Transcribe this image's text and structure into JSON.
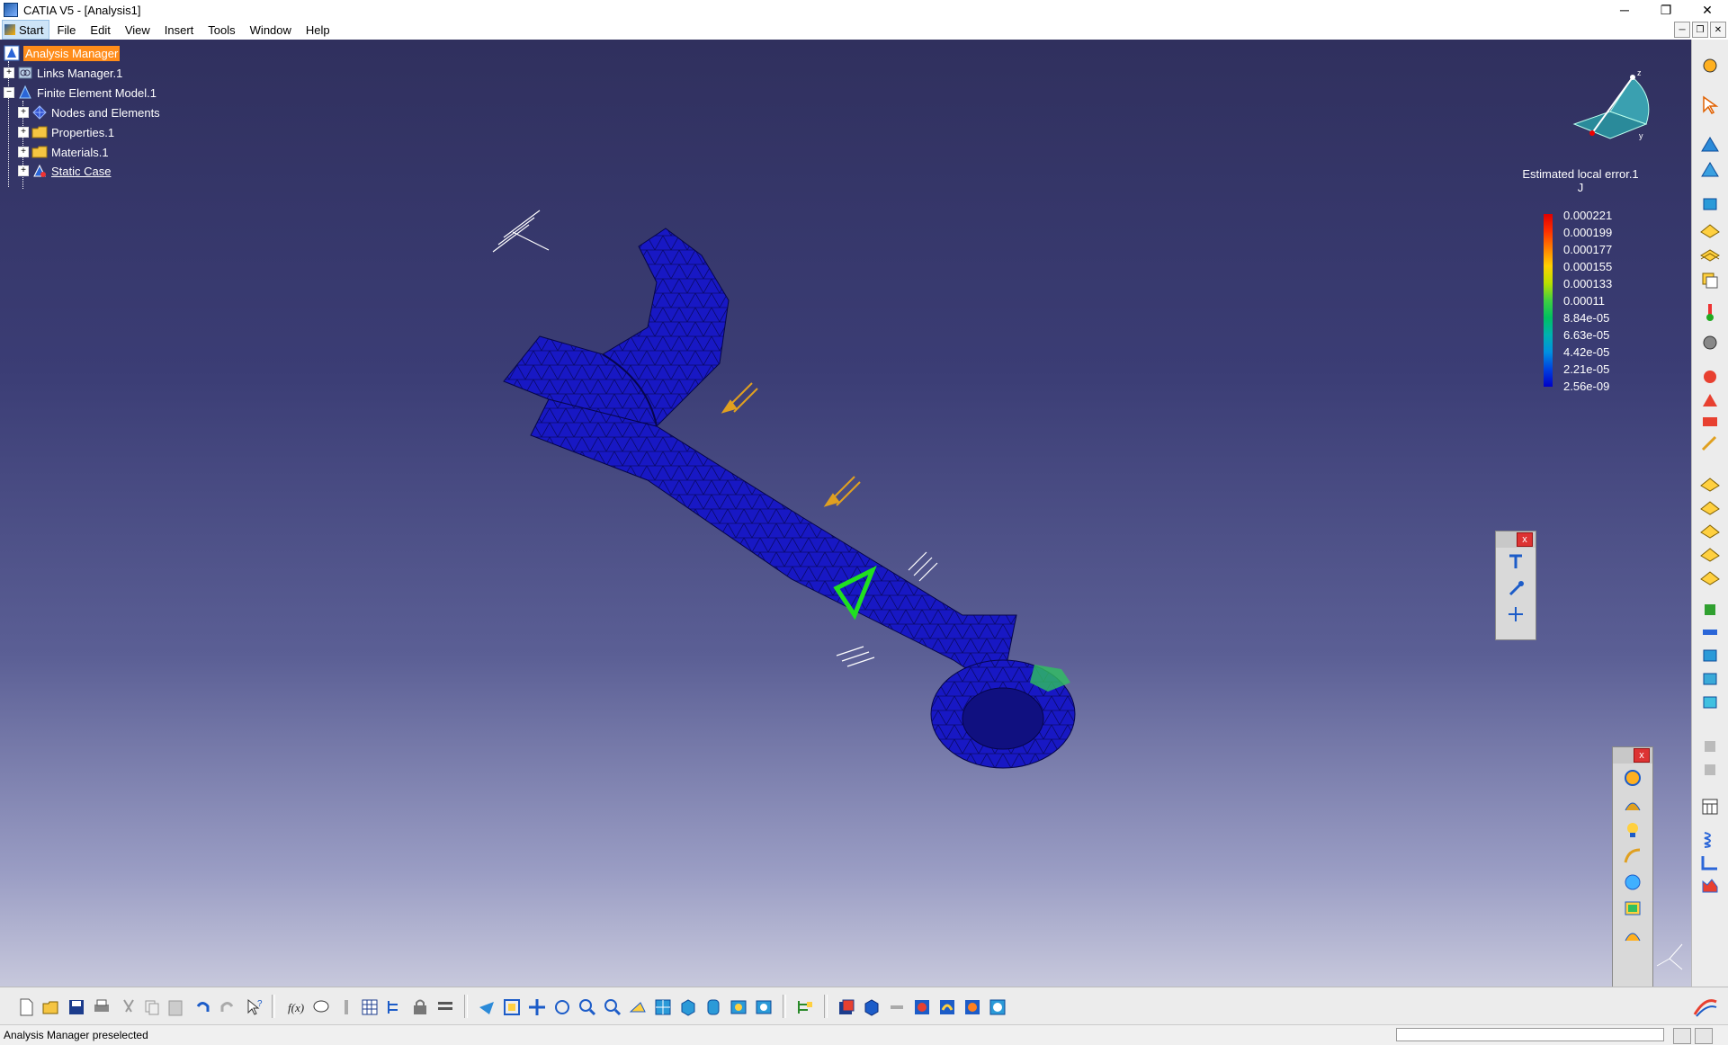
{
  "window": {
    "title": "CATIA V5 - [Analysis1]"
  },
  "menu": {
    "start": "Start",
    "items": [
      "File",
      "Edit",
      "View",
      "Insert",
      "Tools",
      "Window",
      "Help"
    ]
  },
  "tree": {
    "root": "Analysis Manager",
    "links_manager": "Links Manager.1",
    "fem": "Finite Element Model.1",
    "nodes": "Nodes and Elements",
    "properties": "Properties.1",
    "materials": "Materials.1",
    "static_case": "Static Case"
  },
  "legend": {
    "title": "Estimated local error.1",
    "unit": "J",
    "values": [
      "0.000221",
      "0.000199",
      "0.000177",
      "0.000155",
      "0.000133",
      "0.00011",
      "8.84e-05",
      "6.63e-05",
      "4.42e-05",
      "2.21e-05",
      "2.56e-09"
    ]
  },
  "compass": {
    "z_label": "z",
    "y_label": "y"
  },
  "status": {
    "message": "Analysis Manager preselected",
    "command_value": ""
  },
  "colors": {
    "selection": "#ff8c1a",
    "viewport_top": "#30305e",
    "mesh": "#1414c8"
  },
  "icons": {
    "bottom": [
      "new-icon",
      "open-icon",
      "save-icon",
      "print-icon",
      "cut-icon",
      "copy-icon",
      "paste-icon",
      "undo-icon",
      "redo-icon",
      "whats-this-icon",
      "formula-icon",
      "knowledge-icon",
      "measure-icon",
      "table-icon",
      "tree-icon",
      "lock-icon",
      "options-icon",
      "fly-icon",
      "fit-all-icon",
      "pan-icon",
      "rotate-icon",
      "zoom-in-icon",
      "zoom-out-icon",
      "normal-view-icon",
      "multi-view-icon",
      "iso-view-icon",
      "shading-icon",
      "hide-show-icon",
      "swap-visible-icon",
      "spec-tree-icon",
      "compute-icon",
      "mesh-icon",
      "bolt-icon",
      "image-icon",
      "report-icon",
      "sensor-icon"
    ],
    "right": [
      "compass-gear-icon",
      "select-icon",
      "mesh-part-icon",
      "mesh-part2-icon",
      "cube-icon",
      "plane-icon",
      "layers-icon",
      "copy-part-icon",
      "thermometer-icon",
      "sphere-icon",
      "clamp-icon",
      "restraint-icon",
      "load-icon",
      "force-icon",
      "plate-icon",
      "plate2-icon",
      "plate3-icon",
      "plate4-icon",
      "plate5-icon",
      "mass-icon",
      "beam-icon",
      "cube2-icon",
      "cube3-icon",
      "cube4-icon",
      "gray1-icon",
      "gray2-icon",
      "calculator-icon",
      "spring-icon",
      "corner-icon",
      "chart-icon"
    ]
  }
}
